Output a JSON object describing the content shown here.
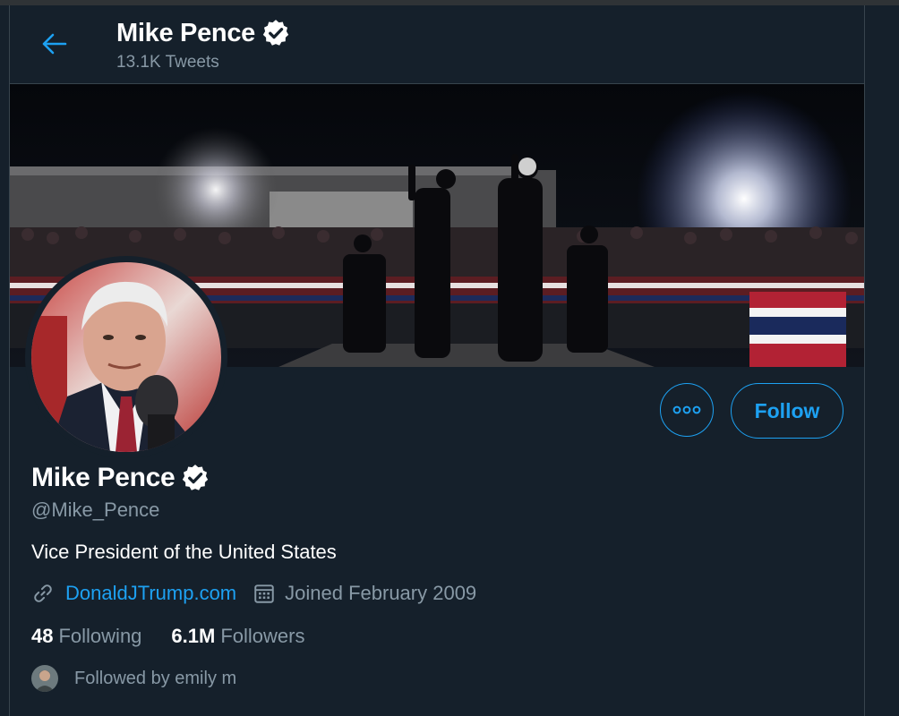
{
  "header": {
    "name": "Mike Pence",
    "tweet_count": "13.1K Tweets"
  },
  "profile": {
    "name": "Mike Pence",
    "handle": "@Mike_Pence",
    "bio": "Vice President of the United States",
    "website": "DonaldJTrump.com",
    "joined": "Joined February 2009",
    "following_count": "48",
    "following_label": "Following",
    "followers_count": "6.1M",
    "followers_label": "Followers",
    "followed_by": "Followed by emily m"
  },
  "actions": {
    "follow_label": "Follow"
  },
  "icons": {
    "back": "arrow-left-icon",
    "verified": "verified-badge-icon",
    "more": "more-horizontal-icon",
    "link": "link-icon",
    "calendar": "calendar-icon"
  },
  "colors": {
    "background": "#15202b",
    "accent": "#1da1f2",
    "secondary_text": "#8899a6",
    "border": "#38444d"
  }
}
